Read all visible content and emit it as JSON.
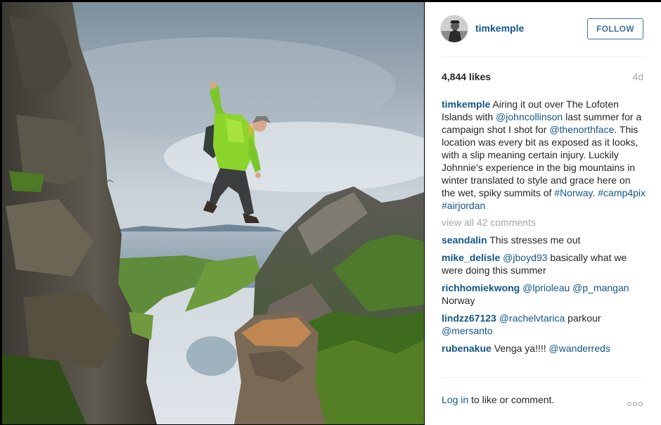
{
  "post": {
    "username": "timkemple",
    "follow_label": "FOLLOW",
    "likes": "4,844 likes",
    "time_ago": "4d",
    "caption": {
      "username": "timkemple",
      "segments": [
        {
          "text": " Airing it out over The Lofoten Islands with ",
          "type": "text"
        },
        {
          "text": "@johncollinson",
          "type": "link"
        },
        {
          "text": " last summer for a campaign shot I shot for ",
          "type": "text"
        },
        {
          "text": "@thenorthface",
          "type": "link"
        },
        {
          "text": ". This location was every bit as exposed as it looks, with a slip meaning certain injury. Luckily Johnnie's experience in the big mountains in winter translated to style and grace here on the wet, spiky summits of ",
          "type": "text"
        },
        {
          "text": "#Norway",
          "type": "link"
        },
        {
          "text": ". ",
          "type": "text"
        },
        {
          "text": "#camp4pix",
          "type": "link"
        },
        {
          "text": " ",
          "type": "text"
        },
        {
          "text": "#airjordan",
          "type": "link"
        }
      ]
    },
    "view_all": "view all 42 comments",
    "comments": [
      {
        "username": "seandalin",
        "segments": [
          {
            "text": " This stresses me out",
            "type": "text"
          }
        ]
      },
      {
        "username": "mike_delisle",
        "segments": [
          {
            "text": " ",
            "type": "text"
          },
          {
            "text": "@jboyd93",
            "type": "link"
          },
          {
            "text": " basically what we were doing this summer",
            "type": "text"
          }
        ]
      },
      {
        "username": "richhomiekwong",
        "segments": [
          {
            "text": " ",
            "type": "text"
          },
          {
            "text": "@lprioleau",
            "type": "link"
          },
          {
            "text": " ",
            "type": "text"
          },
          {
            "text": "@p_mangan",
            "type": "link"
          },
          {
            "text": " Norway",
            "type": "text"
          }
        ]
      },
      {
        "username": "lindzz67123",
        "segments": [
          {
            "text": " ",
            "type": "text"
          },
          {
            "text": "@rachelvtarica",
            "type": "link"
          },
          {
            "text": " parkour ",
            "type": "text"
          },
          {
            "text": "@mersanto",
            "type": "link"
          }
        ]
      },
      {
        "username": "rubenakue",
        "segments": [
          {
            "text": " Venga ya!!!! ",
            "type": "text"
          },
          {
            "text": "@wanderreds",
            "type": "link"
          }
        ]
      }
    ],
    "login_link": "Log in",
    "login_suffix": " to like or comment.",
    "more_icon": "ellipsis-icon"
  },
  "colors": {
    "link": "#125688",
    "follow": "#3f729b",
    "muted": "#a5a7aa"
  }
}
